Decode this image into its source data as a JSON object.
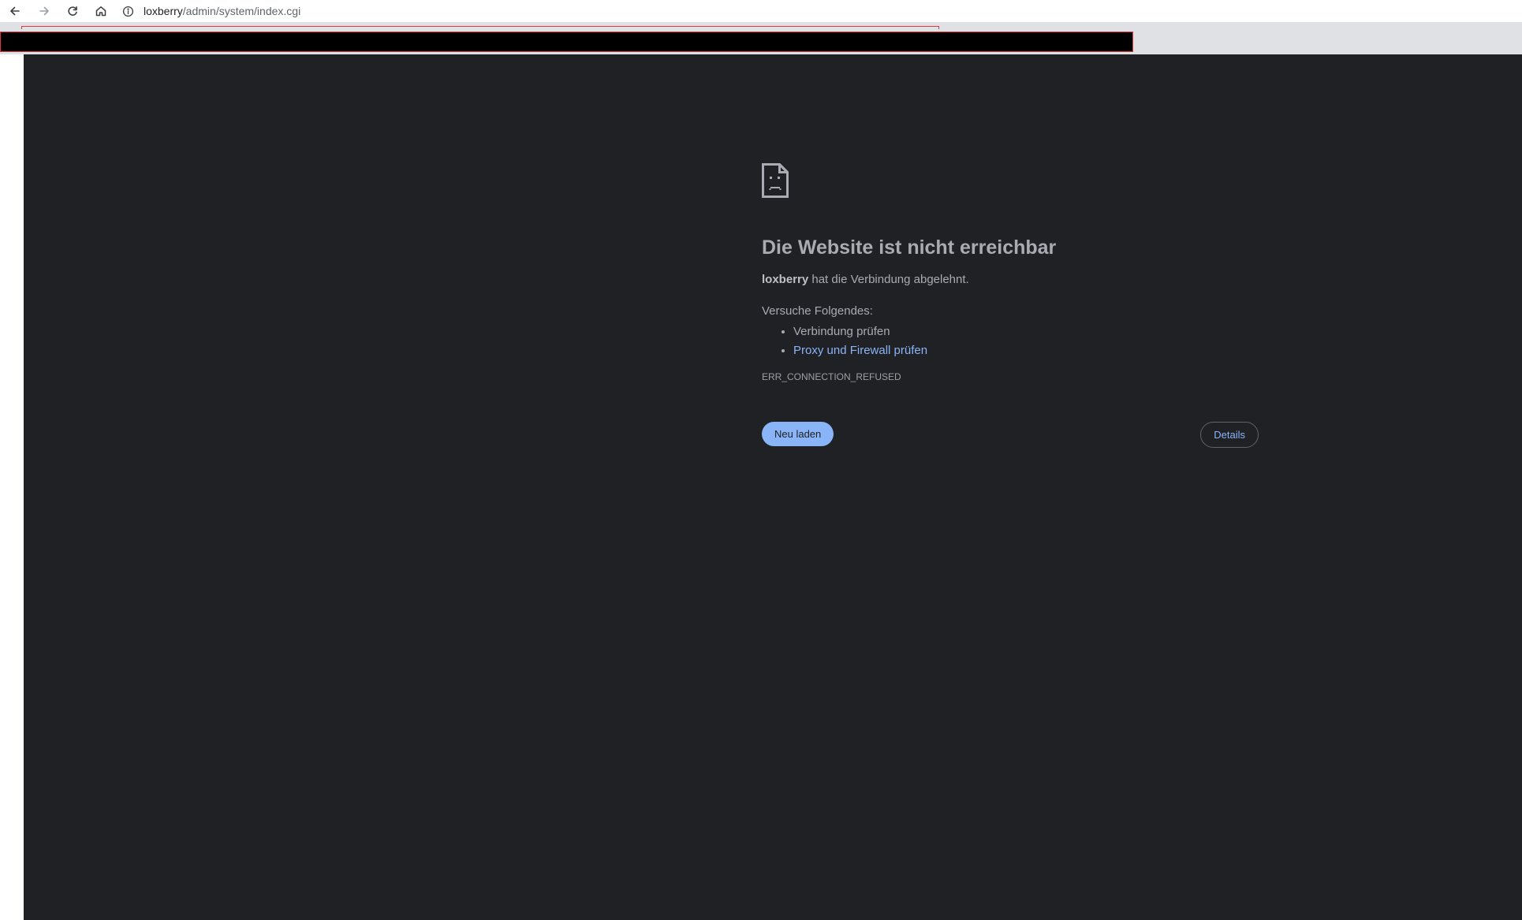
{
  "toolbar": {
    "back_icon": "arrow-left-icon",
    "forward_icon": "arrow-right-icon",
    "reload_icon": "reload-icon",
    "home_icon": "home-icon",
    "site_info_icon": "info-icon",
    "url_host": "loxberry",
    "url_path": "/admin/system/index.cgi"
  },
  "error_page": {
    "icon": "sad-document-icon",
    "headline": "Die Website ist nicht erreichbar",
    "host": "loxberry",
    "description_suffix": " hat die Verbindung abgelehnt.",
    "suggestions_title": "Versuche Folgendes:",
    "suggestions": [
      {
        "label": "Verbindung prüfen",
        "is_link": false
      },
      {
        "label": "Proxy und Firewall prüfen",
        "is_link": true
      }
    ],
    "error_code": "ERR_CONNECTION_REFUSED",
    "reload_label": "Neu laden",
    "details_label": "Details"
  },
  "colors": {
    "page_background": "#202124",
    "accent": "#8ab4f8",
    "text": "#9aa0a6"
  }
}
